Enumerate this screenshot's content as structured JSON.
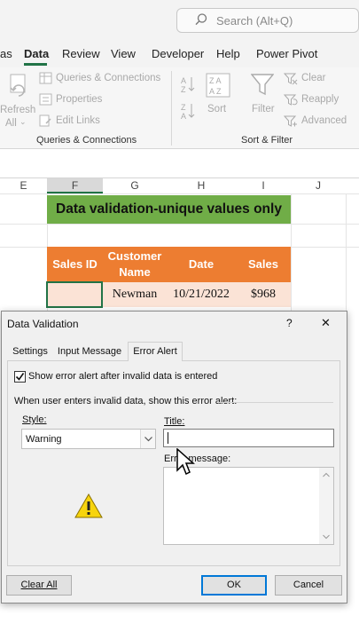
{
  "search": {
    "placeholder": "Search (Alt+Q)"
  },
  "menu": {
    "items": [
      {
        "label": "as"
      },
      {
        "label": "Data"
      },
      {
        "label": "Review"
      },
      {
        "label": "View"
      },
      {
        "label": "Developer"
      },
      {
        "label": "Help"
      },
      {
        "label": "Power Pivot"
      }
    ]
  },
  "ribbon": {
    "refresh": "Refresh",
    "all": "All",
    "queries_connections": "Queries & Connections",
    "properties": "Properties",
    "edit_links": "Edit Links",
    "group1": "Queries & Connections",
    "sort": "Sort",
    "filter": "Filter",
    "clear": "Clear",
    "reapply": "Reapply",
    "advanced": "Advanced",
    "group2": "Sort & Filter"
  },
  "sheet": {
    "columns": [
      "E",
      "F",
      "G",
      "H",
      "I",
      "J"
    ],
    "banner": "Data validation-unique values only",
    "headers": [
      "Sales ID",
      "Customer Name",
      "Date",
      "Sales"
    ],
    "row1": [
      "",
      "Newman",
      "10/21/2022",
      "$968"
    ]
  },
  "dialog": {
    "title": "Data Validation",
    "help": "?",
    "close": "✕",
    "tabs": [
      "Settings",
      "Input Message",
      "Error Alert"
    ],
    "show_alert": "Show error alert after invalid data is entered",
    "when_text": "When user enters invalid data, show this error alert:",
    "style_label": "Style:",
    "style_value": "Warning",
    "title_label": "Title:",
    "error_message_label": "Error message:",
    "clear_all": "Clear All",
    "ok": "OK",
    "cancel": "Cancel"
  }
}
